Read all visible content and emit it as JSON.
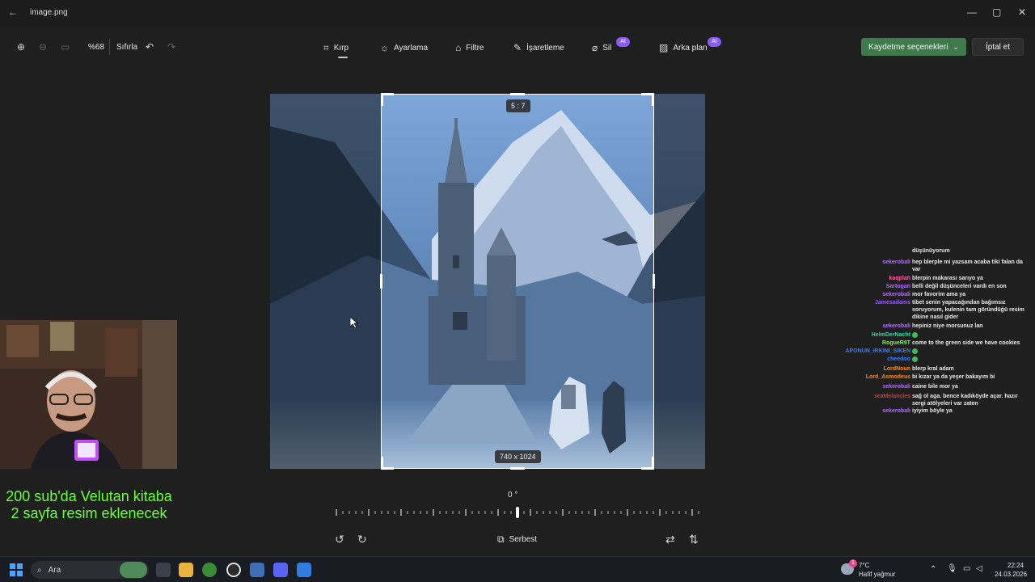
{
  "window": {
    "title": "image.png"
  },
  "toolbar": {
    "zoom_value": "%68",
    "reset_label": "Sıfırla",
    "tools": [
      "Kırp",
      "Ayarlama",
      "Filtre",
      "İşaretleme",
      "Sil",
      "Arka plan"
    ],
    "ai_badge": "AI",
    "save_label": "Kaydetme seçenekleri",
    "cancel_label": "İptal et"
  },
  "crop": {
    "aspect_label": "5 : 7",
    "size_label": "740 x 1024",
    "rotation_label": "0 °",
    "mode_label": "Serbest"
  },
  "chat": [
    {
      "name": "",
      "msg": "düşünüyorum",
      "color": "#e8e8e8"
    },
    {
      "name": "sekerobali",
      "msg": "hep blerple mi yazsam acaba tiki falan da var",
      "color": "#b36bff"
    },
    {
      "name": "kaqplan",
      "msg": "blerpin makarası sarıyo ya",
      "color": "#ff5ca8"
    },
    {
      "name": "Sartogan",
      "msg": "belli değil düşünceleri vardı en son",
      "color": "#b36bff"
    },
    {
      "name": "sekerobali",
      "msg": "mor favorim ama ya",
      "color": "#b36bff"
    },
    {
      "name": "Jamesadams",
      "msg": "tibet senin yapacağından bağımsız soruyorum, kulenin tam göründüğü resim dikine nasıl gider",
      "color": "#9b59ff"
    },
    {
      "name": "sekerobali",
      "msg": "hepiniz niye morsunuz lan",
      "color": "#b36bff"
    },
    {
      "name": "HelmDerNacht",
      "msg": "",
      "color": "#2ed8a3"
    },
    {
      "name": "RogueR9T",
      "msg": "come to the green side we have cookies",
      "color": "#6cff3a"
    },
    {
      "name": "APONUN_IRKINI_SIKEN",
      "msg": "",
      "color": "#3a7bff"
    },
    {
      "name": "cheedoo",
      "msg": "",
      "color": "#3a7bff"
    },
    {
      "name": "LordNoun",
      "msg": "blerp kral adam",
      "color": "#ff8a1f"
    },
    {
      "name": "Lord_Asmodeus",
      "msg": "bi kızar ya da yeşer bakayım bi",
      "color": "#ff8a1f"
    },
    {
      "name": "sekerobali",
      "msg": "caine bile mor ya",
      "color": "#b36bff"
    },
    {
      "name": "seaMelancies",
      "msg": "sağ ol aga. bence kadıköyde açar. hazır sergi atölyeleri var zaten",
      "color": "#e0313a"
    },
    {
      "name": "sekerobali",
      "msg": "iyiyim böyle ya",
      "color": "#b36bff"
    }
  ],
  "stream_overlay": {
    "line1": "200 sub'da Velutan kitaba",
    "line2": "2 sayfa resim eklenecek"
  },
  "taskbar": {
    "search_placeholder": "Ara",
    "weather_temp": "7°C",
    "weather_desc": "Hafif yağmur",
    "weather_alert": "1",
    "time": "22:24",
    "date": "24.03.2026"
  }
}
